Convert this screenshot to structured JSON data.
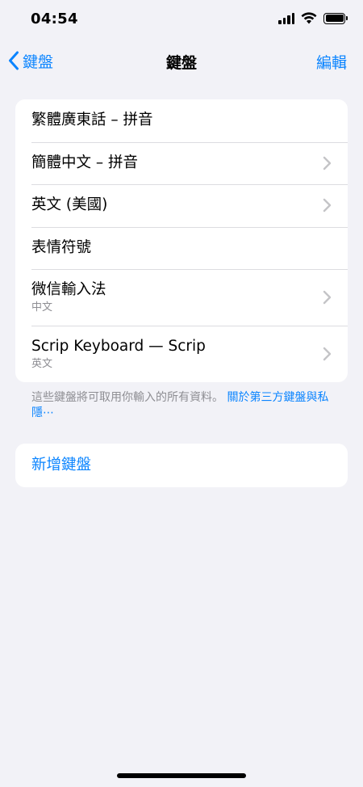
{
  "status_bar": {
    "time": "04:54"
  },
  "nav": {
    "back_label": "鍵盤",
    "title": "鍵盤",
    "edit_label": "編輯"
  },
  "keyboards": [
    {
      "title": "繁體廣東話 – 拼音",
      "subtitle": "",
      "has_chevron": false
    },
    {
      "title": "簡體中文 – 拼音",
      "subtitle": "",
      "has_chevron": true
    },
    {
      "title": "英文 (美國)",
      "subtitle": "",
      "has_chevron": true
    },
    {
      "title": "表情符號",
      "subtitle": "",
      "has_chevron": false
    },
    {
      "title": "微信輸入法",
      "subtitle": "中文",
      "has_chevron": true
    },
    {
      "title": "Scrip Keyboard — Scrip",
      "subtitle": "英文",
      "has_chevron": true
    }
  ],
  "footer": {
    "note": "這些鍵盤將可取用你輸入的所有資料。",
    "link": "關於第三方鍵盤與私隱⋯"
  },
  "add_keyboard": {
    "label": "新增鍵盤"
  },
  "colors": {
    "accent": "#0a84ff",
    "background": "#f2f2f7",
    "secondary_text": "#8e8e93"
  }
}
